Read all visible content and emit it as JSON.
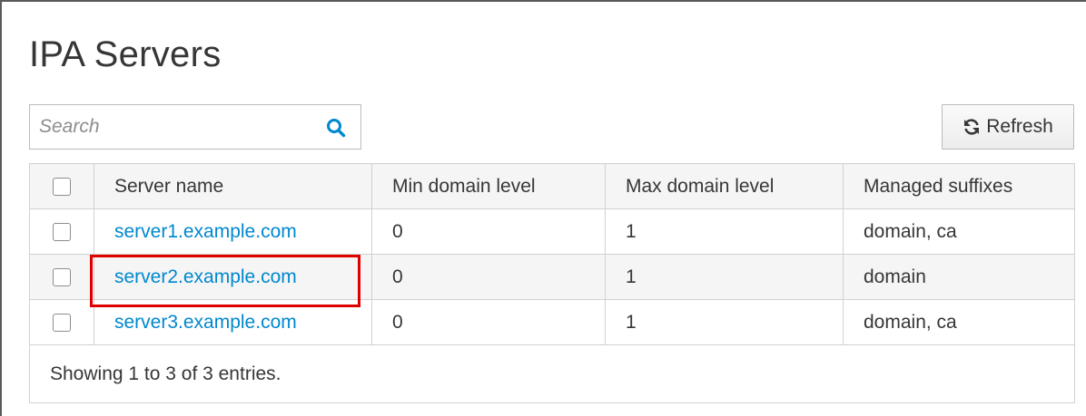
{
  "page": {
    "title": "IPA Servers"
  },
  "search": {
    "placeholder": "Search",
    "value": "",
    "icon": "search-icon"
  },
  "toolbar": {
    "refresh_label": "Refresh",
    "refresh_icon": "refresh-icon"
  },
  "table": {
    "columns": [
      "Server name",
      "Min domain level",
      "Max domain level",
      "Managed suffixes"
    ],
    "rows": [
      {
        "server_name": "server1.example.com",
        "min_domain_level": "0",
        "max_domain_level": "1",
        "managed_suffixes": "domain, ca",
        "checked": false
      },
      {
        "server_name": "server2.example.com",
        "min_domain_level": "0",
        "max_domain_level": "1",
        "managed_suffixes": "domain",
        "checked": false,
        "highlighted": true
      },
      {
        "server_name": "server3.example.com",
        "min_domain_level": "0",
        "max_domain_level": "1",
        "managed_suffixes": "domain, ca",
        "checked": false
      }
    ],
    "footer": "Showing 1 to 3 of 3 entries."
  },
  "colors": {
    "link": "#0088ce",
    "highlight_border": "#e00000",
    "row_stripe": "#f5f5f5",
    "grid_line": "#d1d1d1"
  }
}
